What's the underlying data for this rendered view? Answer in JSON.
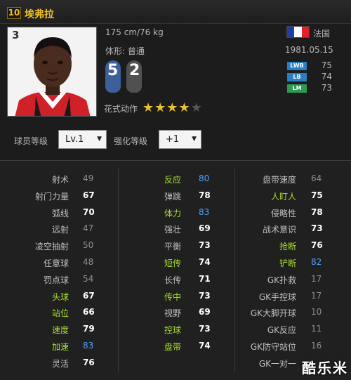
{
  "player": {
    "number": "10",
    "name": "埃弗拉",
    "rating": "3",
    "height_weight": "175 cm/76 kg",
    "body_type": "体形: 普通",
    "left_foot": "5",
    "right_foot": "2",
    "skill_moves_label": "花式动作",
    "skill_stars": 4,
    "skill_stars_max": 5,
    "nation": "法国",
    "birth_date": "1981.05.15",
    "positions": [
      {
        "badge": "LWB",
        "value": "75",
        "color": "#2a7fc4"
      },
      {
        "badge": "LB",
        "value": "74",
        "color": "#2a7fc4"
      },
      {
        "badge": "LM",
        "value": "73",
        "color": "#2e9a52"
      }
    ]
  },
  "controls": {
    "player_level_label": "球员等级",
    "player_level_value": "Lv.1",
    "enhance_label": "强化等级",
    "enhance_value": "+1"
  },
  "stats": {
    "col1": [
      {
        "name": "射术",
        "value": "49",
        "nc": "c-white",
        "vc": "v-gray"
      },
      {
        "name": "射门力量",
        "value": "67",
        "nc": "c-white",
        "vc": "v-white"
      },
      {
        "name": "弧线",
        "value": "70",
        "nc": "c-white",
        "vc": "v-white"
      },
      {
        "name": "远射",
        "value": "47",
        "nc": "c-white",
        "vc": "v-gray"
      },
      {
        "name": "凌空抽射",
        "value": "50",
        "nc": "c-white",
        "vc": "v-gray"
      },
      {
        "name": "任意球",
        "value": "48",
        "nc": "c-white",
        "vc": "v-gray"
      },
      {
        "name": "罚点球",
        "value": "54",
        "nc": "c-white",
        "vc": "v-gray"
      },
      {
        "name": "头球",
        "value": "67",
        "nc": "c-green",
        "vc": "v-white"
      },
      {
        "name": "站位",
        "value": "66",
        "nc": "c-green",
        "vc": "v-white"
      },
      {
        "name": "速度",
        "value": "79",
        "nc": "c-green",
        "vc": "v-white"
      },
      {
        "name": "加速",
        "value": "83",
        "nc": "c-green",
        "vc": "v-blue"
      },
      {
        "name": "灵活",
        "value": "76",
        "nc": "c-white",
        "vc": "v-white"
      }
    ],
    "col2": [
      {
        "name": "反应",
        "value": "80",
        "nc": "c-green",
        "vc": "v-blue"
      },
      {
        "name": "弹跳",
        "value": "78",
        "nc": "c-white",
        "vc": "v-white"
      },
      {
        "name": "体力",
        "value": "83",
        "nc": "c-green",
        "vc": "v-blue"
      },
      {
        "name": "强壮",
        "value": "69",
        "nc": "c-white",
        "vc": "v-white"
      },
      {
        "name": "平衡",
        "value": "73",
        "nc": "c-white",
        "vc": "v-white"
      },
      {
        "name": "短传",
        "value": "74",
        "nc": "c-green",
        "vc": "v-white"
      },
      {
        "name": "长传",
        "value": "71",
        "nc": "c-white",
        "vc": "v-white"
      },
      {
        "name": "传中",
        "value": "73",
        "nc": "c-green",
        "vc": "v-white"
      },
      {
        "name": "视野",
        "value": "69",
        "nc": "c-white",
        "vc": "v-white"
      },
      {
        "name": "控球",
        "value": "73",
        "nc": "c-green",
        "vc": "v-white"
      },
      {
        "name": "盘带",
        "value": "74",
        "nc": "c-green",
        "vc": "v-white"
      }
    ],
    "col3": [
      {
        "name": "盘带速度",
        "value": "64",
        "nc": "c-white",
        "vc": "v-gray"
      },
      {
        "name": "人盯人",
        "value": "75",
        "nc": "c-green",
        "vc": "v-white"
      },
      {
        "name": "侵略性",
        "value": "78",
        "nc": "c-white",
        "vc": "v-white"
      },
      {
        "name": "战术意识",
        "value": "73",
        "nc": "c-white",
        "vc": "v-white"
      },
      {
        "name": "抢断",
        "value": "76",
        "nc": "c-green",
        "vc": "v-white"
      },
      {
        "name": "铲断",
        "value": "82",
        "nc": "c-green",
        "vc": "v-blue"
      },
      {
        "name": "GK扑救",
        "value": "17",
        "nc": "c-white",
        "vc": "v-gray"
      },
      {
        "name": "GK手控球",
        "value": "17",
        "nc": "c-white",
        "vc": "v-gray"
      },
      {
        "name": "GK大脚开球",
        "value": "10",
        "nc": "c-white",
        "vc": "v-gray"
      },
      {
        "name": "GK反应",
        "value": "11",
        "nc": "c-white",
        "vc": "v-gray"
      },
      {
        "name": "GK防守站位",
        "value": "16",
        "nc": "c-white",
        "vc": "v-gray"
      },
      {
        "name": "GK一对一",
        "value": "",
        "nc": "c-white",
        "vc": "v-gray"
      }
    ]
  },
  "colors": {
    "accent_gold": "#f0c020",
    "attr_green": "#a8e030",
    "value_blue": "#4aa0ff",
    "flag": [
      "#1f3fa0",
      "#ffffff",
      "#e0202a"
    ]
  },
  "watermark": "酷乐米"
}
